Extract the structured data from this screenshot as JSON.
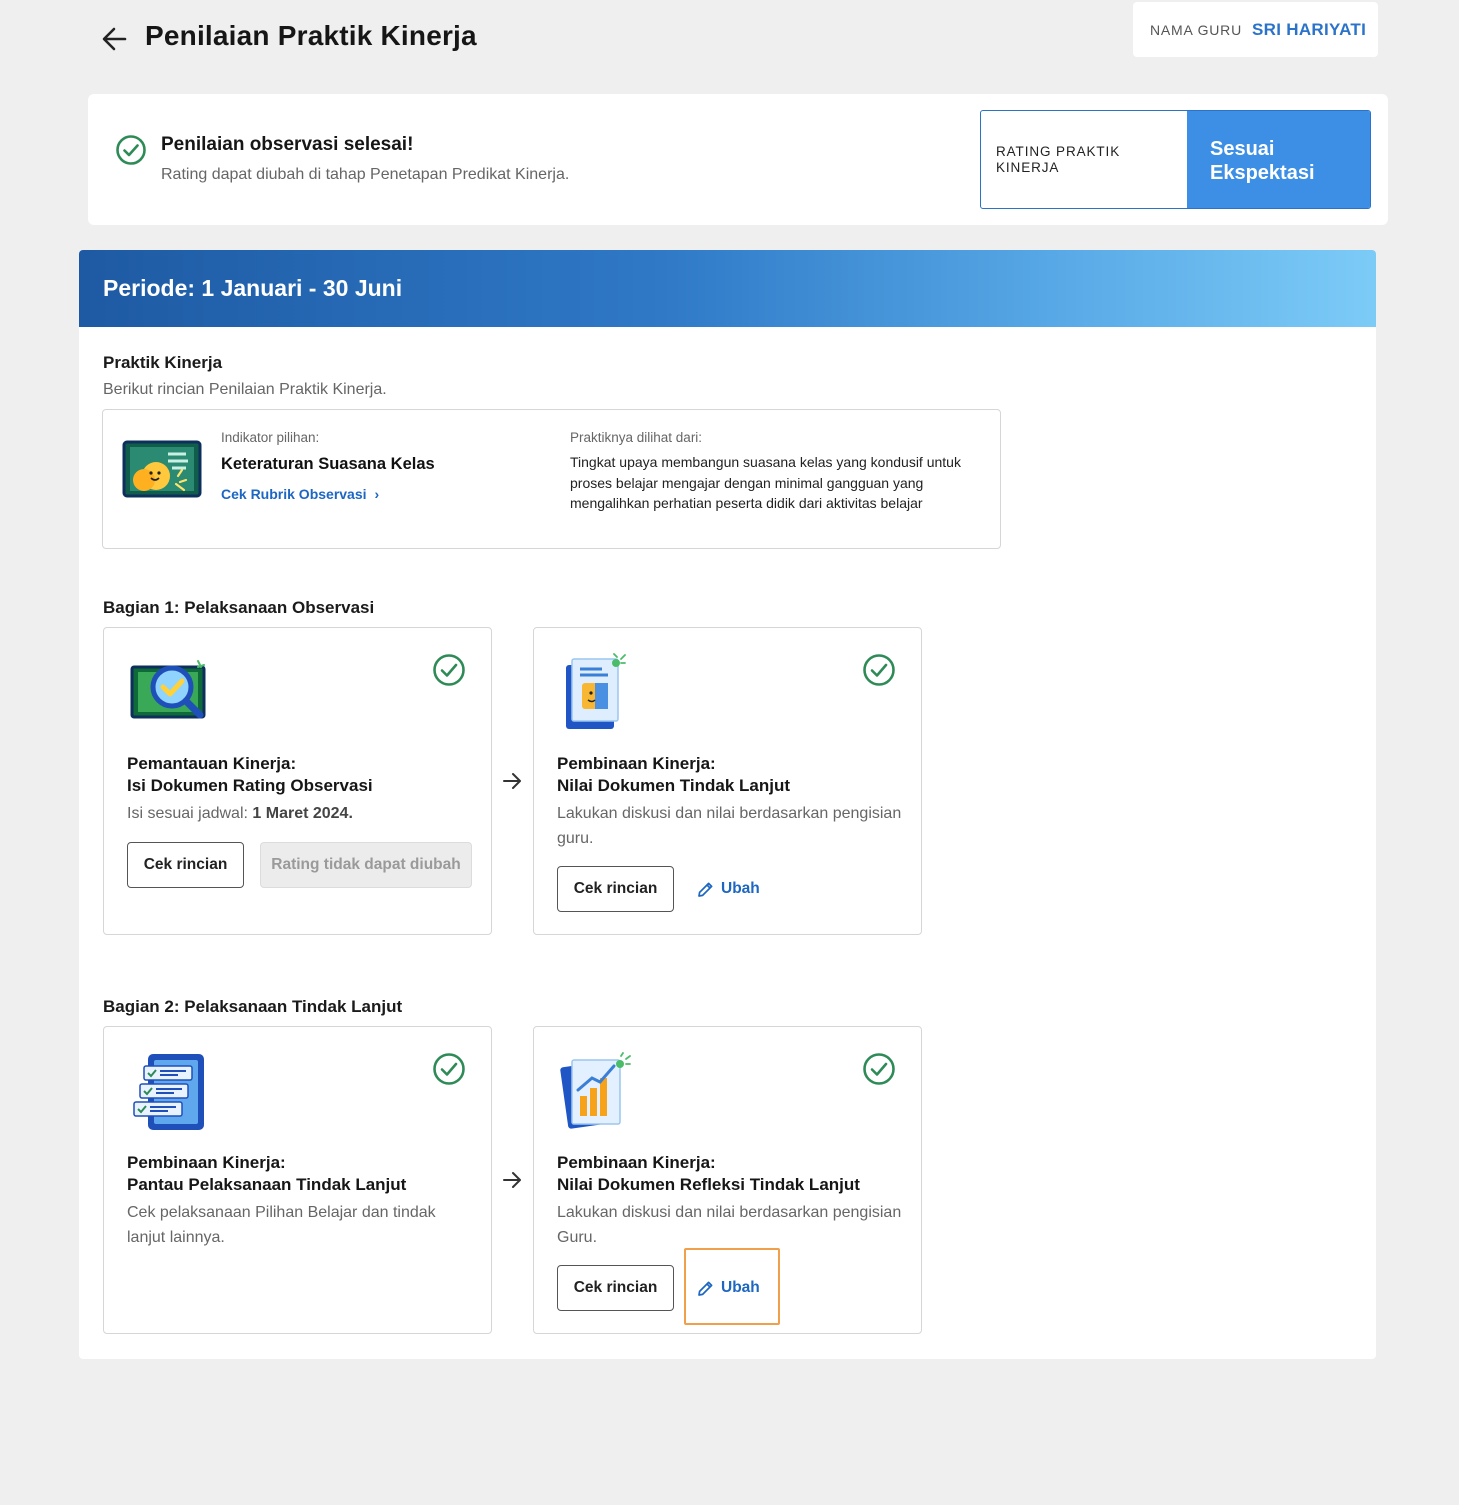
{
  "header": {
    "title": "Penilaian Praktik Kinerja",
    "teacher_label": "NAMA GURU",
    "teacher_name": "SRI HARIYATI"
  },
  "status": {
    "title": "Penilaian observasi selesai!",
    "subtitle": "Rating dapat diubah di tahap Penetapan Predikat Kinerja.",
    "rating_label_line1": "RATING PRAKTIK",
    "rating_label_line2": "KINERJA",
    "rating_value_line1": "Sesuai",
    "rating_value_line2": "Ekspektasi",
    "accent_color": "#3d8fe6"
  },
  "period": {
    "label": "Periode: 1 Januari - 30 Juni"
  },
  "praktik": {
    "title": "Praktik Kinerja",
    "subtitle": "Berikut rincian Penilaian Praktik Kinerja.",
    "indicator_label": "Indikator pilihan:",
    "indicator_title": "Keteraturan Suasana Kelas",
    "rubric_link": "Cek Rubrik Observasi",
    "practice_label": "Praktiknya dilihat dari:",
    "practice_text": "Tingkat upaya membangun suasana kelas yang kondusif untuk proses belajar mengajar dengan minimal gangguan yang mengalihkan perhatian peserta didik dari aktivitas belajar"
  },
  "part1": {
    "title": "Bagian 1: Pelaksanaan Observasi",
    "card1": {
      "title_line1": "Pemantauan Kinerja:",
      "title_line2": "Isi Dokumen Rating Observasi",
      "desc_prefix": "Isi sesuai jadwal: ",
      "desc_date": "1 Maret 2024.",
      "btn_detail": "Cek rincian",
      "btn_disabled": "Rating tidak dapat diubah"
    },
    "card2": {
      "title_line1": "Pembinaan Kinerja:",
      "title_line2": "Nilai Dokumen Tindak Lanjut",
      "desc": "Lakukan diskusi dan nilai berdasarkan pengisian guru.",
      "btn_detail": "Cek rincian",
      "btn_edit": "Ubah"
    }
  },
  "part2": {
    "title": "Bagian 2: Pelaksanaan Tindak Lanjut",
    "card1": {
      "title_line1": "Pembinaan Kinerja:",
      "title_line2": "Pantau Pelaksanaan Tindak Lanjut",
      "desc": "Cek pelaksanaan Pilihan Belajar dan tindak lanjut lainnya."
    },
    "card2": {
      "title_line1": "Pembinaan Kinerja:",
      "title_line2": "Nilai Dokumen Refleksi Tindak Lanjut",
      "desc": "Lakukan diskusi dan nilai berdasarkan pengisian Guru.",
      "btn_detail": "Cek rincian",
      "btn_edit": "Ubah"
    }
  },
  "icons": {
    "back": "arrow-left-icon",
    "check": "check-circle-icon",
    "edit": "pencil-icon",
    "flow": "arrow-right-icon",
    "chevron": "chevron-right-icon"
  },
  "colors": {
    "success": "#2e8b57",
    "link": "#1d66c2",
    "highlight": "#f0a04b"
  }
}
